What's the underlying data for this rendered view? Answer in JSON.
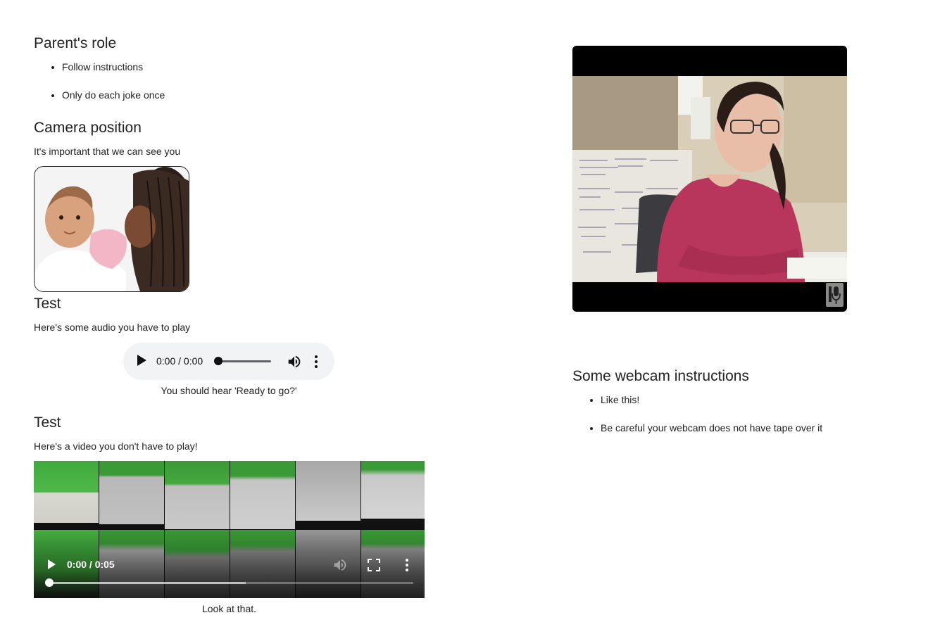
{
  "left": {
    "parent_role": {
      "heading": "Parent's role",
      "items": [
        "Follow instructions",
        "Only do each joke once"
      ]
    },
    "camera_position": {
      "heading": "Camera position",
      "text": "It's important that we can see you"
    },
    "audio_test": {
      "heading": "Test",
      "text": "Here's some audio you have to play",
      "player_time": "0:00 / 0:00",
      "caption": "You should hear 'Ready to go?'"
    },
    "video_test": {
      "heading": "Test",
      "text": "Here's a video you don't have to play!",
      "player_time": "0:00 / 0:05",
      "caption": "Look at that."
    }
  },
  "right": {
    "webcam_instructions": {
      "heading": "Some webcam instructions",
      "items": [
        "Like this!",
        "Be careful your webcam does not have tape over it"
      ]
    }
  },
  "icons": {
    "audio": [
      "play-icon",
      "volume-icon",
      "more-options-icon"
    ],
    "video": [
      "play-icon",
      "mute-icon",
      "fullscreen-icon",
      "more-options-icon"
    ],
    "webcam": [
      "microphone-icon"
    ]
  }
}
